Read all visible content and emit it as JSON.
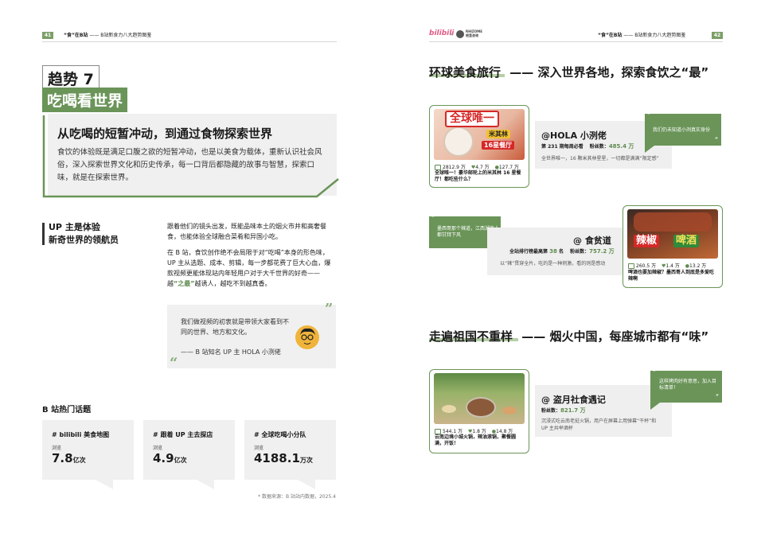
{
  "header": {
    "left_page_num": "41",
    "left_title_bold": "“食”在B站",
    "left_title_rest": "—— B站新食力八大趋势图鉴",
    "right_logo_bili": "bilibili",
    "right_logo_x": "×",
    "right_logo_partner": "RHIZOME",
    "right_logo_partner_sub": "根茎咨询",
    "right_title_bold": "“食”在B站",
    "right_title_rest": "—— B站新食力八大趋势图鉴",
    "right_page_num": "42"
  },
  "trend": {
    "number": "趋势 7",
    "title": "吃喝看世界",
    "headline": "从吃喝的短暂冲动，到通过食物探索世界",
    "body": "食饮的体验既是满足口腹之欲的短暂冲动，也是以美食为载体，重新认识社会风俗，深入探索世界文化和历史传承，每一口背后都隐藏的故事与智慧，探索口味，就是在探索世界。"
  },
  "guide": {
    "label_line1": "UP 主是体验",
    "label_line2": "新奇世界的领航员",
    "para1": "跟着他们的镜头出发，既能品味本土的烟火市井和高奢餐食，也能体验全球融合菜肴和异国小吃。",
    "para2_a": "在 B 站，食饮创作绝不会局限于对“吃喝”本身的形色味，UP 主从选题、成本、剪辑，每一步都花费了巨大心血，爆款视频更能体现站内年轻用户对于大千世界的好奇——越",
    "para2_em": "“之最”",
    "para2_b": "越诱人，越吃不到越真香。"
  },
  "quote": {
    "open": "”",
    "close": "“",
    "text": "我们做视频的初衷就是带领大家看到不同的世界、地方和文化。",
    "attribution": "—— B 站知名 UP 主 HOLA 小洌佬"
  },
  "topics": {
    "heading": "B 站热门话题",
    "items": [
      {
        "tag": "# bilibili 美食地图",
        "label": "浏览",
        "value": "7.8",
        "unit": "亿次"
      },
      {
        "tag": "# 跟着 UP 主去探店",
        "label": "浏览",
        "value": "4.9",
        "unit": "亿次"
      },
      {
        "tag": "# 全球吃喝小分队",
        "label": "浏览",
        "value": "4188.1",
        "unit": "万次"
      }
    ],
    "source": "* 数据来源：B 站站内数据，2025.4"
  },
  "section1": {
    "title_a": "环球美食旅行",
    "title_b": "—— 深入世界各地，探索食饮之“最”"
  },
  "card1": {
    "thumb_big": "全球唯一",
    "thumb_tag1": "米其林",
    "thumb_tag2": "16星餐厅",
    "plays": "2812.9 万",
    "likes": "4.7 万",
    "coins": "127.7 万",
    "caption": "全球唯一！豪华邮轮上的米其林 16 星餐厅！都吃些什么？",
    "handle": "@HOLA 小洌佬",
    "rank": "第 231 期每周必看",
    "fans_label": "粉丝数：",
    "fans": "485.4 万",
    "desc": "全世界唯一，16 颗米其林星星，一切都是满满“限定感”",
    "bubble": "我们仍未知道小洌真实身份",
    "bubble_q1": "“",
    "bubble_q2": "”"
  },
  "card2": {
    "bubble": "墨西哥那个辣道，江西湖南人都甘拜下风",
    "bubble_q1": "“",
    "bubble_q2": "”",
    "handle": "@ 食贫道",
    "rank_a": "全站排行榜最高第",
    "rank_num": "38",
    "rank_b": "名",
    "fans_label": "粉丝数：",
    "fans": "757.2 万",
    "desc": "以“辣”贯穿全片，吃的是一种刺激，看的则是感动",
    "thumb_big_a": "辣椒",
    "thumb_big_b": "啤酒",
    "plays": "260.5 万",
    "likes": "1.4 万",
    "coins": "13.2 万",
    "caption": "啤酒也要加辣椒？墨西哥人到底是多爱吃辣啊"
  },
  "section2": {
    "title_a": "走遍祖国不重样",
    "title_b": "—— 烟火中国，每座城市都有“味”"
  },
  "card3": {
    "plays": "544.1 万",
    "likes": "1.8 万",
    "coins": "14.8 万",
    "caption": "云南边境小城火锅，辣油滚锅，聚餐圆满，开饭！",
    "handle": "@ 盗月社食遇记",
    "fans_label": "粉丝数：",
    "fans": "821.7 万",
    "desc": "沉浸式吃云南老挝火锅，用户在屏幕上用弹幕“干杯”和 UP 主共举酒杯",
    "bubble": "这样烤肉好有意思，加入目标清单！",
    "bubble_q1": "“",
    "bubble_q2": "”"
  },
  "colors": {
    "accent": "#6a9458",
    "accent_light": "#b6cfa6",
    "card_gray": "#f0f0f0"
  }
}
